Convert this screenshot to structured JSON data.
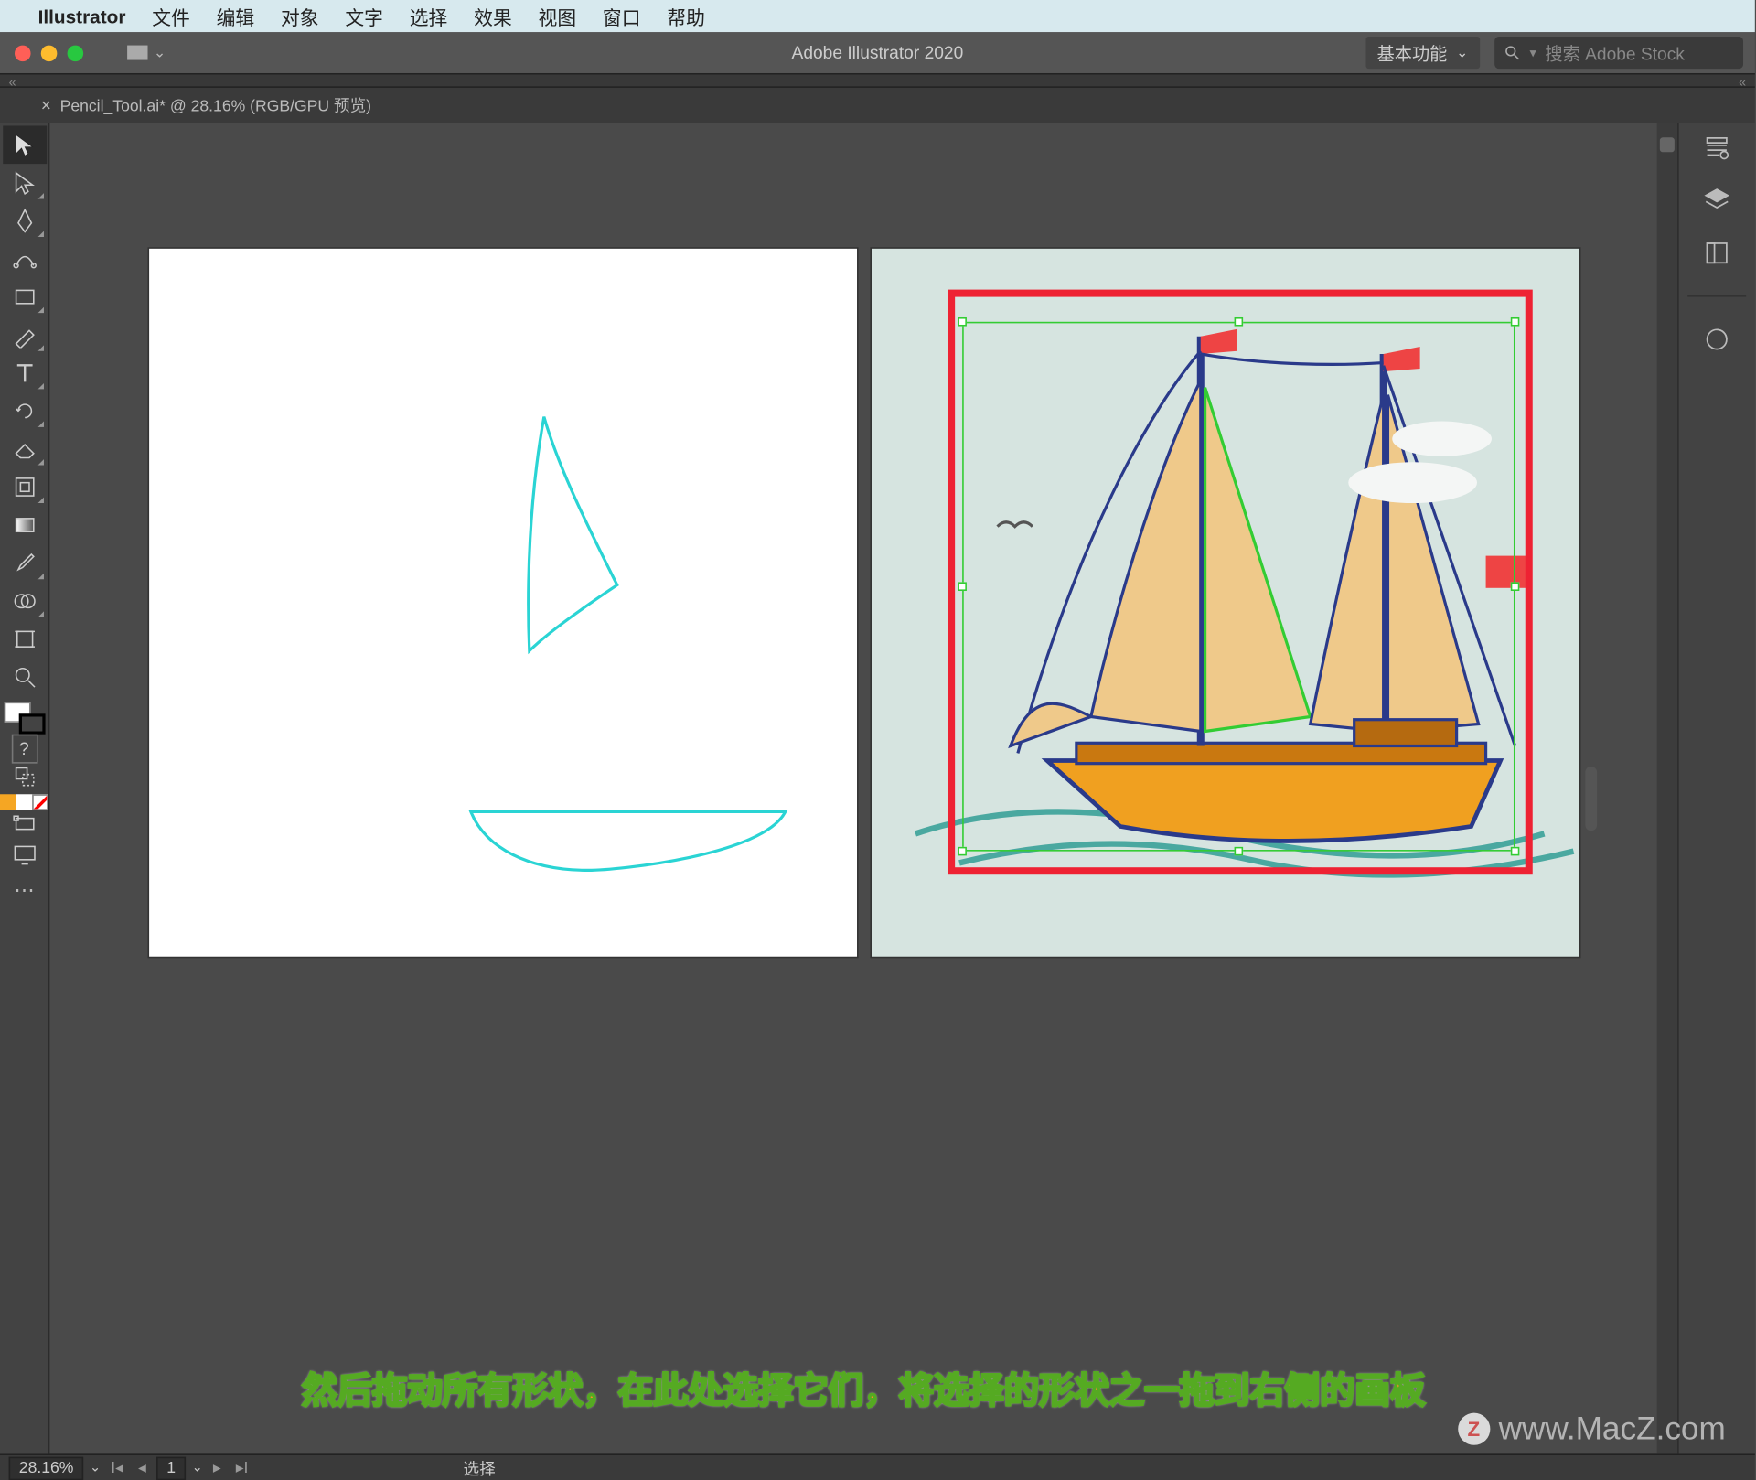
{
  "menubar": {
    "app": "Illustrator",
    "items": [
      "文件",
      "编辑",
      "对象",
      "文字",
      "选择",
      "效果",
      "视图",
      "窗口",
      "帮助"
    ]
  },
  "titlebar": {
    "app_title": "Adobe Illustrator 2020",
    "workspace": "基本功能",
    "search_placeholder": "搜索 Adobe Stock"
  },
  "document_tab": {
    "label": "Pencil_Tool.ai* @ 28.16% (RGB/GPU 预览)"
  },
  "tools": [
    {
      "name": "selection-tool",
      "selected": true
    },
    {
      "name": "direct-selection-tool"
    },
    {
      "name": "pen-tool"
    },
    {
      "name": "curvature-tool"
    },
    {
      "name": "rectangle-tool"
    },
    {
      "name": "paintbrush-tool"
    },
    {
      "name": "type-tool"
    },
    {
      "name": "rotate-tool"
    },
    {
      "name": "eraser-tool"
    },
    {
      "name": "scissors-tool"
    },
    {
      "name": "gradient-tool"
    },
    {
      "name": "eyedropper-tool"
    },
    {
      "name": "shape-builder-tool"
    },
    {
      "name": "artboard-tool"
    },
    {
      "name": "zoom-tool"
    }
  ],
  "right_panels": [
    "properties-icon",
    "layers-icon",
    "libraries-icon",
    "appearance-icon"
  ],
  "instruction_text": "然后拖动所有形状，在此处选择它们，将选择的形状之一拖到右侧的画板",
  "watermark": "www.MacZ.com",
  "status": {
    "zoom": "28.16%",
    "artboard_index": "1",
    "tool_label": "选择"
  }
}
